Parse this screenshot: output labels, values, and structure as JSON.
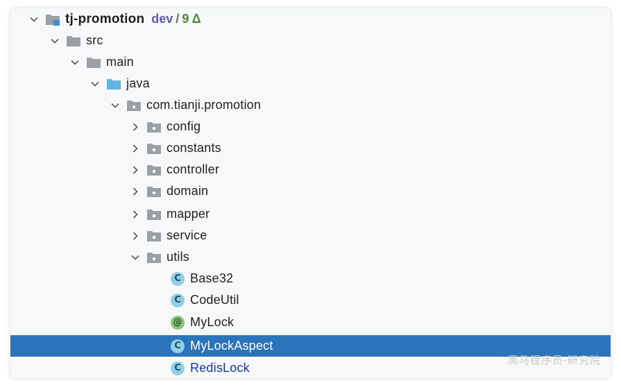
{
  "project": {
    "name": "tj-promotion",
    "branch": "dev",
    "separator": "/",
    "changes": "9 Δ"
  },
  "tree": {
    "src": "src",
    "main": "main",
    "java": "java",
    "package": "com.tianji.promotion",
    "config": "config",
    "constants": "constants",
    "controller": "controller",
    "domain": "domain",
    "mapper": "mapper",
    "service": "service",
    "utils": "utils",
    "base32": "Base32",
    "codeutil": "CodeUtil",
    "mylock": "MyLock",
    "mylockaspect": "MyLockAspect",
    "redislock": "RedisLock"
  },
  "badges": {
    "class_letter": "C",
    "annotation_letter": "@"
  },
  "colors": {
    "selection": "#2b74bb",
    "folder": "#9aa0a6",
    "source_folder": "#62b4e3",
    "class_icon": "#90cfe6",
    "annotation_icon": "#8bc47a",
    "branch": "#5b5bb0",
    "changes": "#4f8a33",
    "modified_file": "#17339e"
  },
  "watermark": "黑马程序员-研究院"
}
